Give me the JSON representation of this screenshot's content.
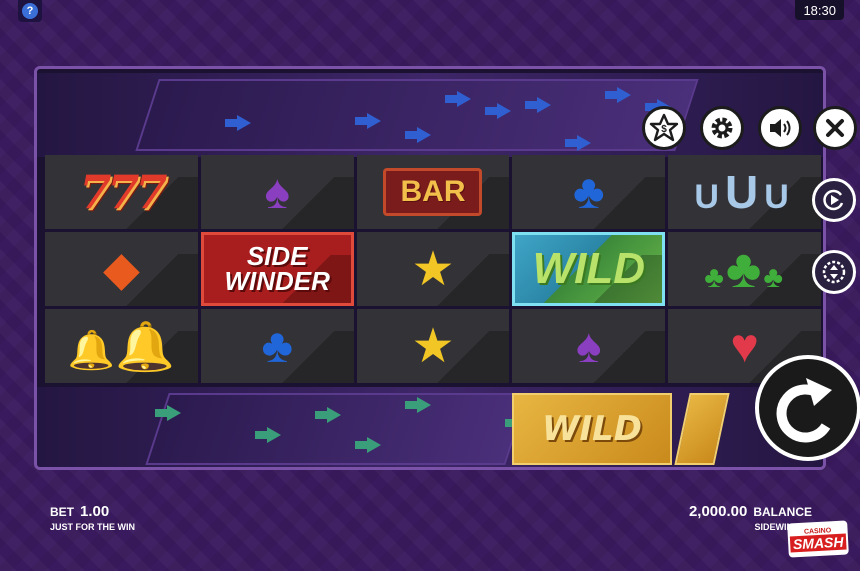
{
  "top_bar": {
    "help_label": "?",
    "clock": "18:30"
  },
  "reels": {
    "rows": [
      [
        {
          "symbol": "777",
          "kind": "seven"
        },
        {
          "symbol": "spade",
          "kind": "spade"
        },
        {
          "symbol": "BAR",
          "kind": "bar"
        },
        {
          "symbol": "club",
          "kind": "club"
        },
        {
          "symbol": "horseshoes",
          "kind": "shoe"
        }
      ],
      [
        {
          "symbol": "diamond",
          "kind": "diamond"
        },
        {
          "symbol": "SIDEWINDER",
          "kind": "side"
        },
        {
          "symbol": "star",
          "kind": "star"
        },
        {
          "symbol": "WILD",
          "kind": "wild"
        },
        {
          "symbol": "clovers",
          "kind": "clover"
        }
      ],
      [
        {
          "symbol": "bells",
          "kind": "bell"
        },
        {
          "symbol": "club",
          "kind": "club"
        },
        {
          "symbol": "star",
          "kind": "star"
        },
        {
          "symbol": "spade",
          "kind": "spade"
        },
        {
          "symbol": "heart",
          "kind": "heart"
        }
      ]
    ],
    "sidewinder_line1": "SIDE",
    "sidewinder_line2": "WINDER",
    "bar_text": "BAR",
    "wild_text": "WILD",
    "seven_text": "777"
  },
  "bottom_track": {
    "wild_text": "WILD"
  },
  "controls": {
    "paytable_icon": "star-dollar-icon",
    "settings_icon": "gear-icon",
    "sound_icon": "speaker-icon",
    "close_icon": "close-icon",
    "autoplay_icon": "autoplay-icon",
    "stake_icon": "chip-icon",
    "spin_icon": "spin-arrow-icon"
  },
  "footer": {
    "bet_label": "BET",
    "bet_value": "1.00",
    "bet_sub": "JUST FOR THE WIN",
    "balance_value": "2,000.00",
    "balance_label": "BALANCE",
    "balance_sub": "SIDEWINDER",
    "logo_top": "CASINO",
    "logo_main": "SMASH"
  },
  "colors": {
    "background": "#3a1a5e",
    "frame": "#7a52a8",
    "top_arrows": "#2f5fd0",
    "bottom_arrows": "#3a9e7a"
  }
}
